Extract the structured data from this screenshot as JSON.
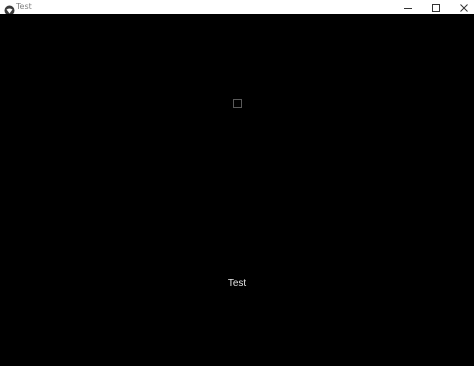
{
  "window": {
    "title": "Test",
    "icon": "app-logo-icon",
    "controls": [
      "minimize-icon",
      "maximize-icon",
      "close-icon"
    ]
  },
  "content": {
    "checkbox": {
      "checked": false
    },
    "label": "Test"
  },
  "colors": {
    "background": "#000000",
    "titlebar": "#ffffff",
    "title_text": "#808080",
    "label_text": "#e6e6e6",
    "checkbox_border": "#5a5a5a"
  }
}
